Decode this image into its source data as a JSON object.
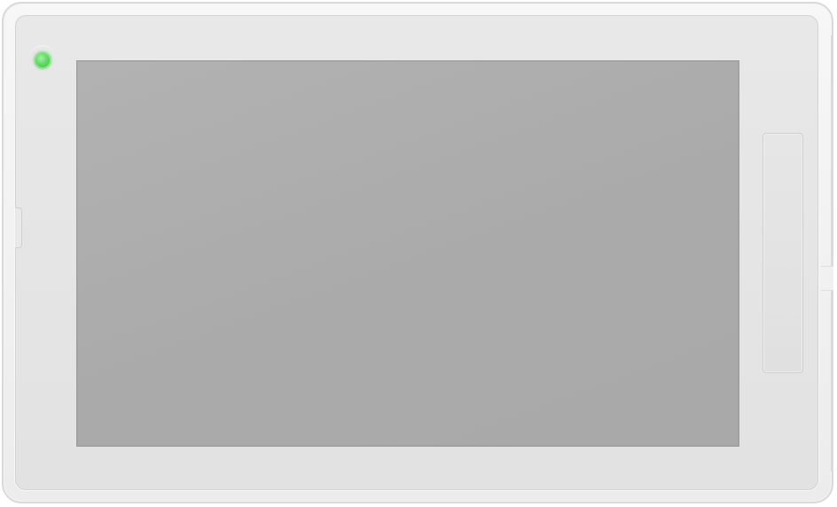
{
  "device": {
    "type": "wall-panel-tablet",
    "status_led": {
      "state": "on",
      "color": "#5fd35f"
    },
    "frame_color": "#ececec",
    "screen_color": "#acacac",
    "screen_state": "off"
  }
}
